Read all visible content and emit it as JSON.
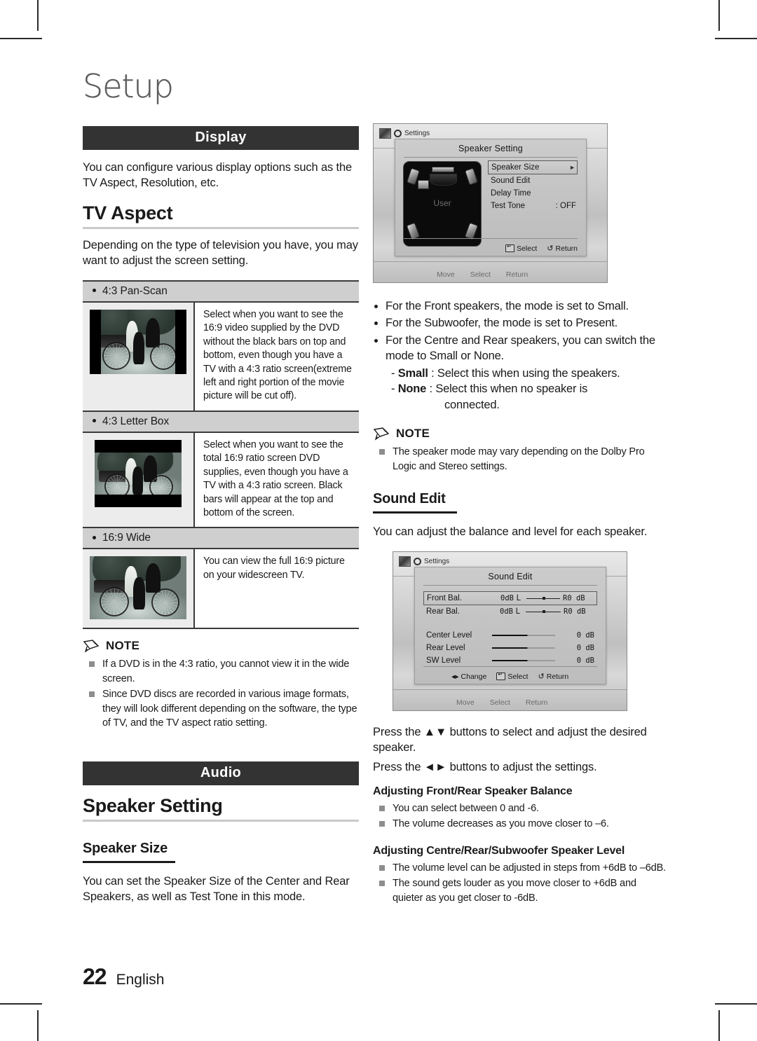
{
  "chapter": {
    "title": "Setup"
  },
  "footer": {
    "page_number": "22",
    "language": "English"
  },
  "left": {
    "display_section": {
      "bar_label": "Display",
      "intro": "You can configure various display options such as the TV Aspect, Resolution, etc.",
      "heading": "TV Aspect",
      "heading_body": "Depending on the type of television you have, you may want to adjust the screen setting.",
      "rows": [
        {
          "label": "4:3 Pan-Scan",
          "description": "Select when you want to see the 16:9 video supplied by the DVD without the black bars on top and bottom, even though you have a TV with a 4:3 ratio screen(extreme left and right portion of the movie picture will be cut off).",
          "thumb": "pan-scan-thumbnail"
        },
        {
          "label": "4:3 Letter Box",
          "description": "Select when you want to see the total 16:9 ratio screen DVD supplies, even though you have a TV with a 4:3 ratio screen. Black bars will appear at the top and bottom of the screen.",
          "thumb": "letter-box-thumbnail"
        },
        {
          "label": "16:9 Wide",
          "description": "You can view the full 16:9 picture on your widescreen TV.",
          "thumb": "wide-thumbnail"
        }
      ],
      "note": {
        "label": "NOTE",
        "items": [
          "If a DVD is in the 4:3 ratio, you cannot view it in the wide screen.",
          "Since DVD discs are recorded in various image formats, they will look different depending on the software, the type of TV, and the TV aspect ratio setting."
        ]
      }
    },
    "audio_section": {
      "bar_label": "Audio",
      "heading": "Speaker Setting",
      "sub_heading": "Speaker Size",
      "body": "You can set the Speaker Size of the Center and Rear Speakers, as well as Test Tone in this mode."
    }
  },
  "right": {
    "speaker_setting_osd": {
      "settings_tab_label": "Settings",
      "dialog_title": "Speaker Setting",
      "panel_label": "User",
      "menu": [
        {
          "label": "Speaker Size",
          "value": "",
          "arrow": "►",
          "selected": true
        },
        {
          "label": "Sound Edit",
          "value": "",
          "arrow": "",
          "selected": false
        },
        {
          "label": "Delay Time",
          "value": "",
          "arrow": "",
          "selected": false
        },
        {
          "label": "Test Tone",
          "value": ":  OFF",
          "arrow": "",
          "selected": false
        }
      ],
      "footer_hints": [
        {
          "icon": "enter-key-icon",
          "label": "Select"
        },
        {
          "icon": "return-arrow-icon",
          "label": "Return"
        }
      ],
      "behind_hints": [
        {
          "icon": "move-icon",
          "label": "Move"
        },
        {
          "icon": "enter-key-icon",
          "label": "Select"
        },
        {
          "icon": "return-arrow-icon",
          "label": "Return"
        }
      ]
    },
    "speaker_bullets": [
      "For the Front speakers, the mode is set to Small.",
      "For the Subwoofer, the mode is set to Present.",
      "For the Centre and Rear speakers, you can switch the mode to Small or None."
    ],
    "speaker_options": [
      {
        "name": "Small",
        "sep": ":",
        "text": "Select this when using the speakers."
      },
      {
        "name": "None",
        "sep": ":",
        "text": "Select this when no speaker is",
        "text2": "connected."
      }
    ],
    "note": {
      "label": "NOTE",
      "items": [
        "The speaker mode may vary depending on the Dolby Pro Logic and Stereo settings."
      ]
    },
    "sound_edit": {
      "heading": "Sound Edit",
      "body": "You can adjust the balance and level for each speaker.",
      "osd": {
        "settings_tab_label": "Settings",
        "dialog_title": "Sound Edit",
        "balance_rows": [
          {
            "label": "Front  Bal.",
            "left_db": "0dB",
            "left_ch": "L",
            "right_ch": "R",
            "right_db": "0 dB",
            "selected": true
          },
          {
            "label": "Rear  Bal.",
            "left_db": "0dB",
            "left_ch": "L",
            "right_ch": "R",
            "right_db": "0 dB",
            "selected": false
          }
        ],
        "level_rows": [
          {
            "label": "Center  Level",
            "value": "0 dB"
          },
          {
            "label": "Rear  Level",
            "value": "0 dB"
          },
          {
            "label": "SW  Level",
            "value": "0 dB"
          }
        ],
        "footer_hints": [
          {
            "icon": "left-right-arrows-icon",
            "label": "Change"
          },
          {
            "icon": "enter-key-icon",
            "label": "Select"
          },
          {
            "icon": "return-arrow-icon",
            "label": "Return"
          }
        ],
        "behind_hints": [
          {
            "icon": "move-icon",
            "label": "Move"
          },
          {
            "icon": "enter-key-icon",
            "label": "Select"
          },
          {
            "icon": "return-arrow-icon",
            "label": "Return"
          }
        ]
      },
      "instructions": [
        "Press the ▲▼ buttons to select and adjust the desired speaker.",
        "Press the ◄► buttons to adjust the settings."
      ],
      "balance_heading": "Adjusting Front/Rear Speaker Balance",
      "balance_items": [
        "You can select between 0 and -6.",
        "The volume decreases as you move closer to –6."
      ],
      "level_heading": "Adjusting Centre/Rear/Subwoofer Speaker Level",
      "level_items": [
        "The volume level can be adjusted in steps from +6dB to –6dB.",
        "The sound gets louder as you move closer to +6dB and quieter as you get closer to -6dB."
      ]
    }
  }
}
